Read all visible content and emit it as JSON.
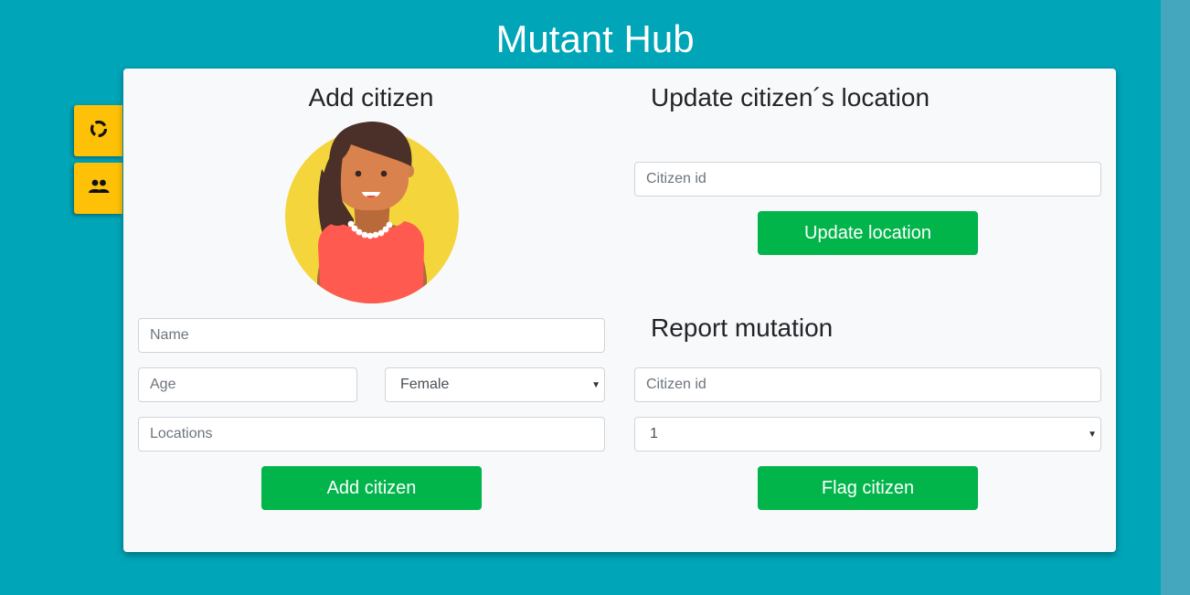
{
  "app": {
    "title": "Mutant Hub"
  },
  "sidebar": {
    "tabs": [
      {
        "icon": "donut-chart-icon"
      },
      {
        "icon": "people-icon"
      }
    ]
  },
  "add_citizen": {
    "heading": "Add citizen",
    "avatar": "female-avatar",
    "name_placeholder": "Name",
    "age_placeholder": "Age",
    "gender_selected": "Female",
    "locations_placeholder": "Locations",
    "submit_label": "Add citizen"
  },
  "update_location": {
    "heading": "Update citizen´s location",
    "citizen_id_placeholder": "Citizen id",
    "submit_label": "Update location"
  },
  "report_mutation": {
    "heading": "Report mutation",
    "citizen_id_placeholder": "Citizen id",
    "mutation_selected": "1",
    "submit_label": "Flag citizen"
  },
  "colors": {
    "background": "#00a5b8",
    "card": "#f8f9fa",
    "button": "#02b54b",
    "side_tab": "#ffc107"
  }
}
